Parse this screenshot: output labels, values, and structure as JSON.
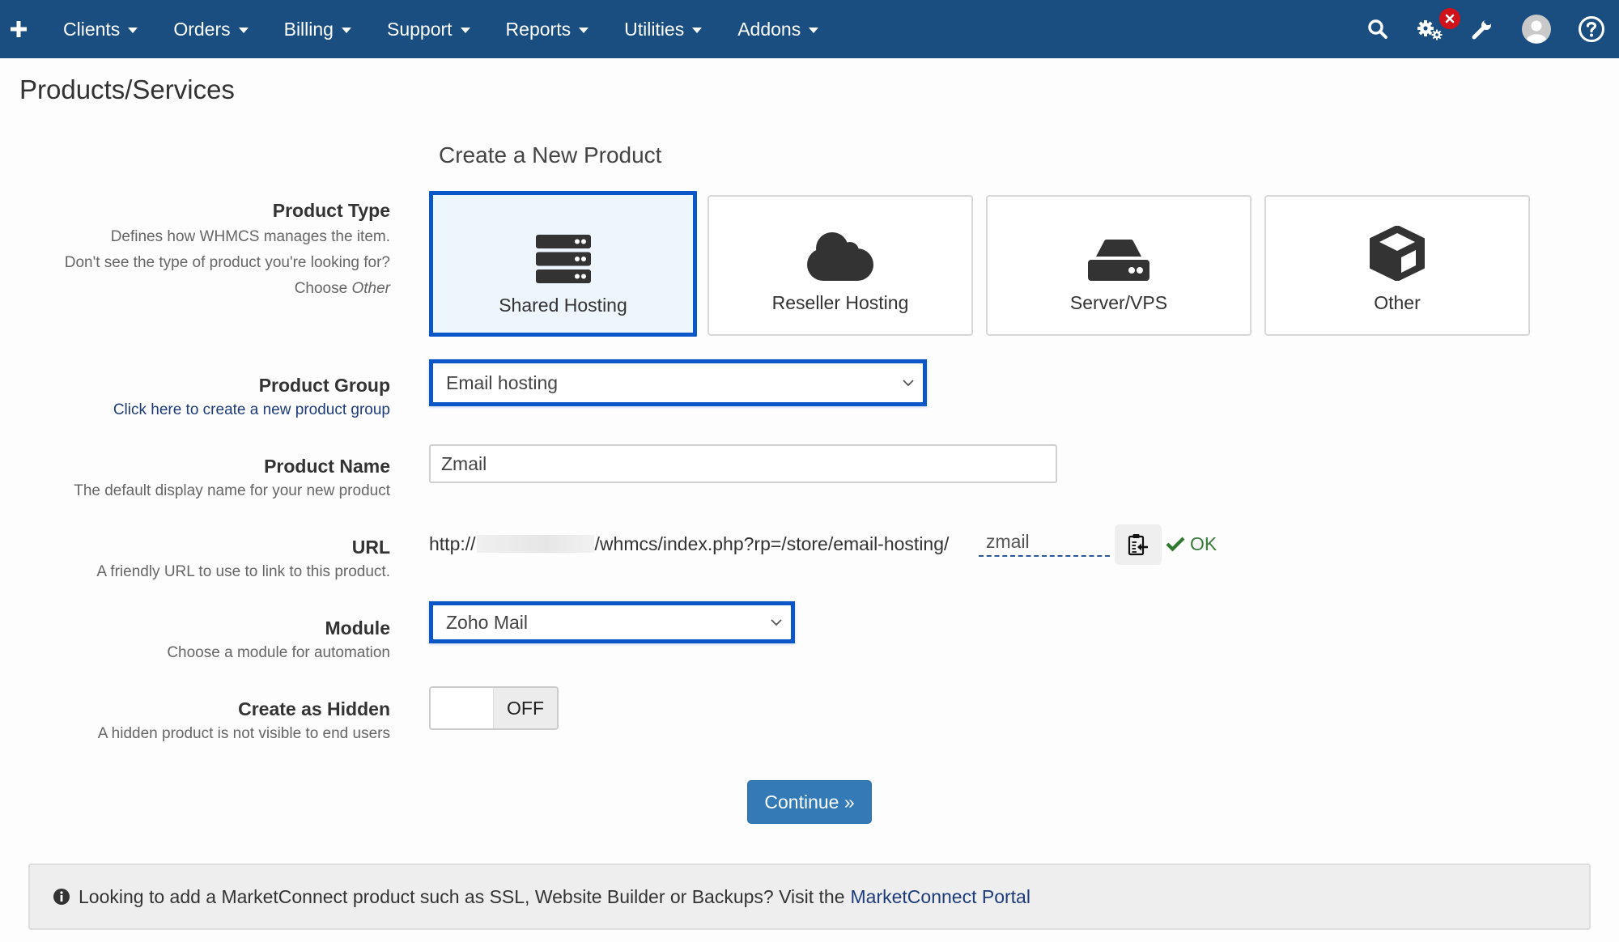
{
  "nav": {
    "add_icon": "plus-icon",
    "items": [
      {
        "label": "Clients"
      },
      {
        "label": "Orders"
      },
      {
        "label": "Billing"
      },
      {
        "label": "Support"
      },
      {
        "label": "Reports"
      },
      {
        "label": "Utilities"
      },
      {
        "label": "Addons"
      }
    ],
    "right_icons": [
      "search-icon",
      "gears-icon",
      "wrench-icon",
      "user-avatar-icon",
      "help-icon"
    ],
    "alert_badge_icon": "close-x-icon"
  },
  "page": {
    "title": "Products/Services",
    "section_title": "Create a New Product"
  },
  "product_type": {
    "label": "Product Type",
    "help_lines": [
      "Defines how WHMCS manages the item.",
      "Don't see the type of product you're looking for?"
    ],
    "choose_prefix": "Choose",
    "choose_emphasis": "Other",
    "options": [
      {
        "label": "Shared Hosting",
        "icon": "server-stack-icon",
        "selected": true
      },
      {
        "label": "Reseller Hosting",
        "icon": "cloud-icon",
        "selected": false
      },
      {
        "label": "Server/VPS",
        "icon": "hdd-icon",
        "selected": false
      },
      {
        "label": "Other",
        "icon": "cube-icon",
        "selected": false
      }
    ]
  },
  "product_group": {
    "label": "Product Group",
    "link": "Click here to create a new product group",
    "value": "Email hosting"
  },
  "product_name": {
    "label": "Product Name",
    "help": "The default display name for your new product",
    "value": "Zmail"
  },
  "url": {
    "label": "URL",
    "help": "A friendly URL to use to link to this product.",
    "prefix": "http://",
    "path": "/whmcs/index.php?rp=/store/email-hosting/",
    "slug": "zmail",
    "status": "OK"
  },
  "module": {
    "label": "Module",
    "help": "Choose a module for automation",
    "value": "Zoho Mail"
  },
  "hidden": {
    "label": "Create as Hidden",
    "help": "A hidden product is not visible to end users",
    "state": "OFF"
  },
  "actions": {
    "continue_label": "Continue »"
  },
  "info": {
    "text": "Looking to add a MarketConnect product such as SSL, Website Builder or Backups? Visit the",
    "link": "MarketConnect Portal"
  },
  "colors": {
    "nav_bg": "#1a4d80",
    "selected_border": "#0b57c8",
    "primary_button": "#337ab7",
    "ok_green": "#3a7a3a",
    "badge_red": "#d0121b"
  }
}
